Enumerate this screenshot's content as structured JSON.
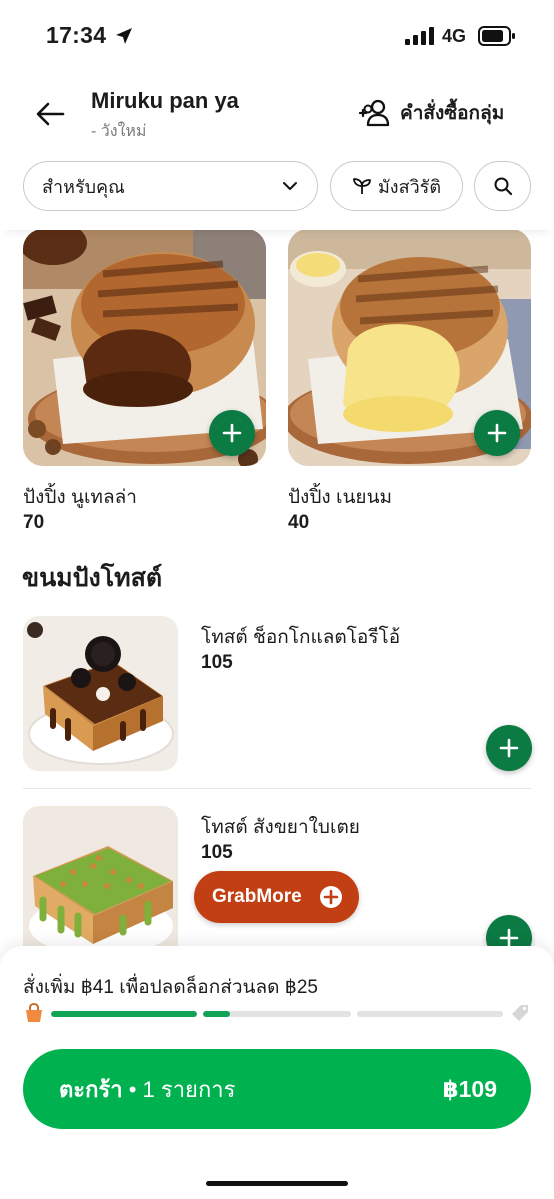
{
  "status_bar": {
    "time": "17:34",
    "network": "4G"
  },
  "header": {
    "store_name": "Miruku pan ya",
    "store_branch": "- วังใหม่",
    "group_order_label": "คำสั่งซื้อกลุ่ม"
  },
  "filters": {
    "category_label": "สำหรับคุณ",
    "vegetarian_label": "มังสวิรัติ"
  },
  "featured_items": [
    {
      "name": "ปังปิ้ง นูเทลล่า",
      "price": "70"
    },
    {
      "name": "ปังปิ้ง เนยนม",
      "price": "40"
    }
  ],
  "section": {
    "title": "ขนมปังโทสต์",
    "items": [
      {
        "name": "โทสต์ ช็อกโกแลตโอรีโอ้",
        "price": "105"
      },
      {
        "name": "โทสต์ สังขยาใบเตย",
        "price": "105"
      }
    ]
  },
  "grabmore": {
    "label": "GrabMore"
  },
  "cart_sheet": {
    "promo_text": "สั่งเพิ่ม ฿41 เพื่อปลดล็อกส่วนลด ฿25",
    "progress_segments": [
      1.0,
      0.18,
      0.0,
      0.0
    ],
    "cart_label_prefix": "ตะกร้า",
    "cart_label_count": "• 1 รายการ",
    "cart_total": "฿109"
  },
  "colors": {
    "brand_green": "#00b14f",
    "add_button_green": "#0b7a43",
    "grabmore_orange": "#c23f13"
  }
}
